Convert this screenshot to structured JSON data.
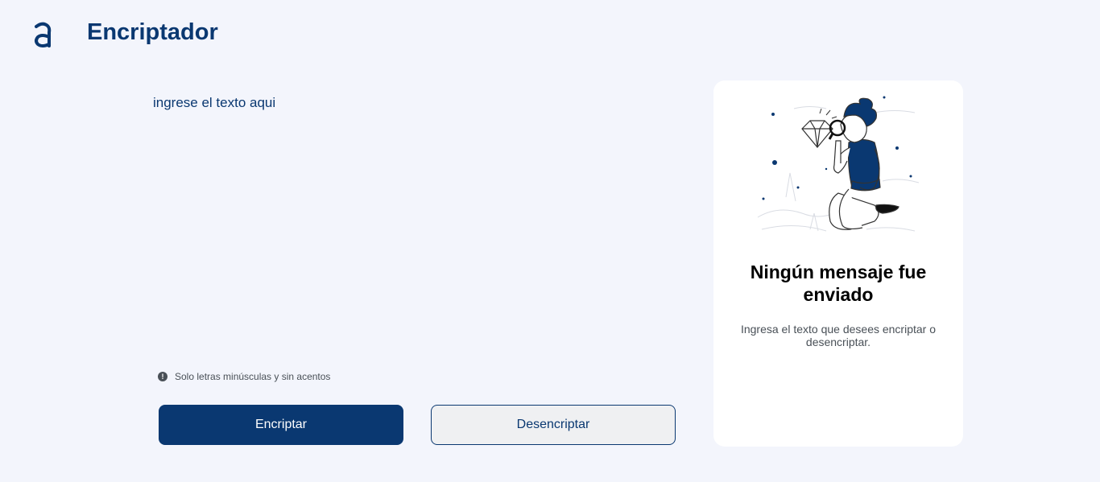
{
  "header": {
    "title": "Encriptador",
    "logo_icon": "alura-logo-icon"
  },
  "input": {
    "placeholder": "ingrese el texto aqui",
    "value": ""
  },
  "hint": {
    "icon": "exclamation-circle-icon",
    "text": "Solo letras minúsculas y sin acentos"
  },
  "buttons": {
    "encrypt_label": "Encriptar",
    "decrypt_label": "Desencriptar"
  },
  "output_panel": {
    "illustration": "person-with-magnifying-glass-illustration",
    "title": "Ningún mensaje fue enviado",
    "description": "Ingresa el texto que desees encriptar o desencriptar."
  },
  "colors": {
    "background": "#f3f5fc",
    "primary": "#0a3871",
    "secondary_button_bg": "#eff0f2",
    "panel_bg": "#ffffff",
    "muted_text": "#495057"
  }
}
